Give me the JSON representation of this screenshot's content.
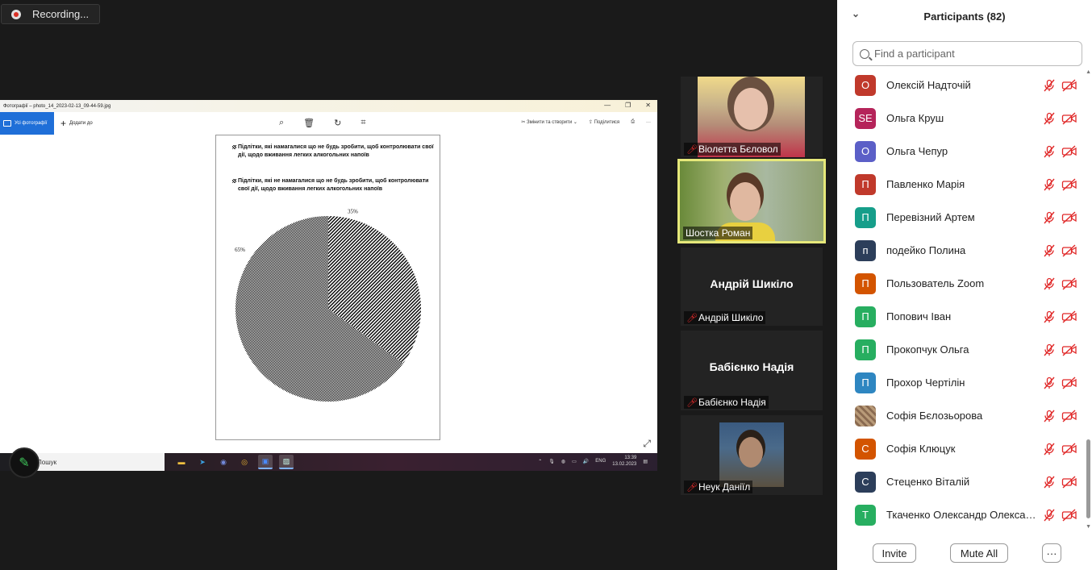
{
  "recording": {
    "label": "Recording..."
  },
  "shared_window": {
    "title": "Фотографії – photo_14_2023-02-13_09-44-59.jpg",
    "all_photos": "Усі фотографії",
    "add_to": "Додати до",
    "edit_create": "Змінити та створити",
    "share": "Поділитися",
    "more": "···"
  },
  "document": {
    "legend": [
      "Підлітки, які намагалися що не будь зробити, щоб контролювати свої дії, щодо вживання легких алкогольних напоїв",
      "Підлітки, які не намагалися що не будь зробити, щоб контролювати свої дії, щодо вживання легких алкогольних напоїв"
    ],
    "chart_data": {
      "type": "pie",
      "categories": [
        "Підлітки, які намагалися що не будь зробити, щоб контролювати свої дії, щодо вживання легких алкогольних напоїв",
        "Підлітки, які не намагалися що не будь зробити, щоб контролювати свої дії, щодо вживання легких алкогольних напоїв"
      ],
      "values": [
        35,
        65
      ],
      "labels": [
        "35%",
        "65%"
      ]
    }
  },
  "taskbar": {
    "search": "Пошук",
    "lang": "ENG",
    "time": "13:39",
    "date": "13.02.2023"
  },
  "videos": [
    {
      "name": "Віолетта Бєловол",
      "muted": true,
      "video": true
    },
    {
      "name": "Шостка Роман",
      "muted": false,
      "video": true,
      "active": true
    },
    {
      "name": "Андрій Шикіло",
      "display": "Андрій Шикіло",
      "muted": true,
      "video": false
    },
    {
      "name": "Бабієнко Надія",
      "display": "Бабієнко Надія",
      "muted": true,
      "video": false
    },
    {
      "name": "Неук Даніїл",
      "muted": true,
      "video": true
    }
  ],
  "participants": {
    "title": "Participants (82)",
    "search_placeholder": "Find a participant",
    "list": [
      {
        "initials": "О",
        "name": "Олексій Надточій",
        "color": "#c0392b"
      },
      {
        "initials": "SE",
        "name": "Ольга Круш",
        "color": "#b5245a"
      },
      {
        "initials": "О",
        "name": "Ольга Чепур",
        "color": "#5b5fc7"
      },
      {
        "initials": "П",
        "name": "Павленко Марія",
        "color": "#c0392b"
      },
      {
        "initials": "П",
        "name": "Перевізний Артем",
        "color": "#169e8a"
      },
      {
        "initials": "п",
        "name": "подейко Полина",
        "color": "#2c3e5a"
      },
      {
        "initials": "П",
        "name": "Пользователь Zoom",
        "color": "#d35400"
      },
      {
        "initials": "П",
        "name": "Попович Іван",
        "color": "#27ae60"
      },
      {
        "initials": "П",
        "name": "Прокопчук Ольга",
        "color": "#27ae60"
      },
      {
        "initials": "П",
        "name": "Прохор Чертілін",
        "color": "#2e86c1"
      },
      {
        "initials": "",
        "name": "Софія Бєлозьорова",
        "color": "#a08060"
      },
      {
        "initials": "С",
        "name": "Софія Клюцук",
        "color": "#d35400"
      },
      {
        "initials": "С",
        "name": "Стеценко Віталій",
        "color": "#2c3e5a"
      },
      {
        "initials": "Т",
        "name": "Ткаченко Олександр Олександрович",
        "color": "#27ae60"
      }
    ],
    "invite": "Invite",
    "mute_all": "Mute All",
    "more": "···"
  }
}
